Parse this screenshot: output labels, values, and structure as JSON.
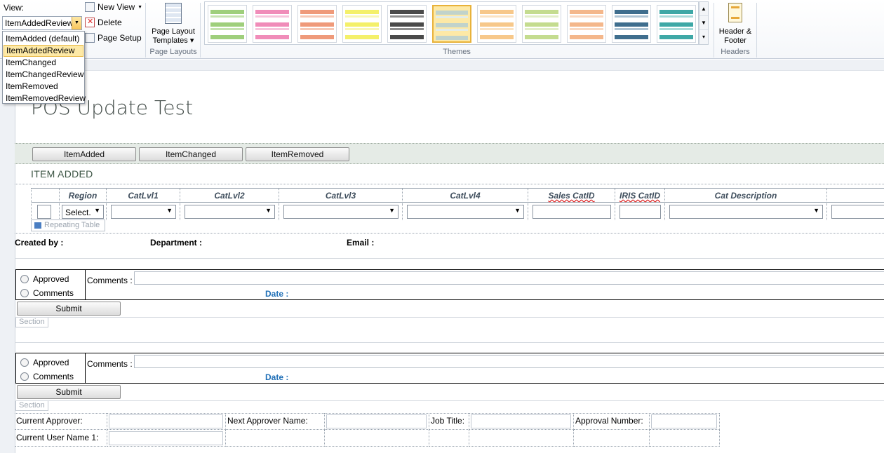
{
  "ribbon": {
    "view_label": "View:",
    "view_value": "ItemAddedReview",
    "new_view": "New View",
    "delete": "Delete",
    "page_setup": "Page Setup",
    "page_layout_templates": "Page Layout Templates",
    "page_layouts_group": "Page Layouts",
    "themes_group": "Themes",
    "header_footer": "Header & Footer",
    "headers_group": "Headers",
    "themes": [
      {
        "colors": [
          "#9fcf7c",
          "#c6e3b0"
        ]
      },
      {
        "colors": [
          "#f08cb9",
          "#f7c4dc"
        ]
      },
      {
        "colors": [
          "#ef9a7a",
          "#f7c9b6"
        ]
      },
      {
        "colors": [
          "#f4f06a",
          "#f9f7b7"
        ]
      },
      {
        "colors": [
          "#4a4a4a",
          "#8d8d8d"
        ]
      },
      {
        "colors": [
          "#c1d3cb",
          "#e3ece7"
        ]
      },
      {
        "colors": [
          "#f7c88a",
          "#fbe3c2"
        ]
      },
      {
        "colors": [
          "#c4dc8f",
          "#e2eec8"
        ]
      },
      {
        "colors": [
          "#f4b78b",
          "#fad9c2"
        ]
      },
      {
        "colors": [
          "#3f6e8e",
          "#aec4d4"
        ]
      },
      {
        "colors": [
          "#3ea8a6",
          "#a8dbda"
        ]
      }
    ]
  },
  "view_dropdown": {
    "items": [
      "ItemAdded (default)",
      "ItemAddedReview",
      "ItemChanged",
      "ItemChangedReview",
      "ItemRemoved",
      "ItemRemovedReview"
    ],
    "selected": "ItemAddedReview"
  },
  "form": {
    "title": "POS Update Test",
    "buttons": [
      "ItemAdded",
      "ItemChanged",
      "ItemRemoved"
    ],
    "section_heading": "ITEM ADDED",
    "table_headers": [
      "Region",
      "CatLvl1",
      "CatLvl2",
      "CatLvl3",
      "CatLvl4",
      "Sales CatID",
      "IRIS CatID",
      "Cat Description"
    ],
    "region_select": "Select.",
    "repeating_table_label": "Repeating Table",
    "created_by": "Created by :",
    "department": "Department :",
    "email": "Email :",
    "approval": {
      "approved": "Approved",
      "comments_option": "Comments",
      "comments_label": "Comments :",
      "date_label": "Date :",
      "submit": "Submit",
      "section_tag": "Section"
    },
    "bottom": {
      "current_approver": "Current Approver:",
      "next_approver": "Next Approver Name:",
      "job_title": "Job Title:",
      "approval_number": "Approval Number:",
      "current_user": "Current User Name 1:"
    }
  }
}
